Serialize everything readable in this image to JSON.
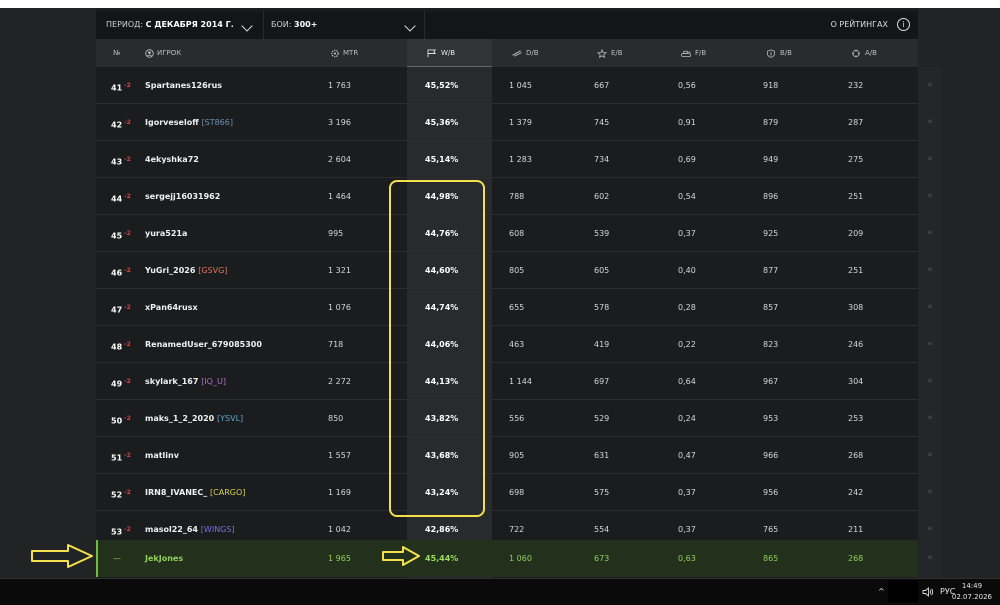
{
  "filters": {
    "period_label": "ПЕРИОД:",
    "period_value": "С ДЕКАБРЯ 2014 Г.",
    "battles_label": "БОИ:",
    "battles_value": "300+",
    "about_ratings": "О РЕЙТИНГАХ"
  },
  "columns": [
    "№",
    "ИГРОК",
    "MTR",
    "W/B",
    "D/B",
    "E/B",
    "F/B",
    "B/B",
    "A/B"
  ],
  "rows": [
    {
      "rank": "41",
      "change": "-2",
      "player": "Spartanes126rus",
      "clan": "",
      "clan_color": "",
      "mtr": "1 763",
      "wb": "45,52%",
      "db": "1 045",
      "eb": "667",
      "fb": "0,56",
      "bb": "918",
      "ab": "232"
    },
    {
      "rank": "42",
      "change": "-2",
      "player": "Igorveseloff",
      "clan": "[ST866]",
      "clan_color": "#6c8fb5",
      "mtr": "3 196",
      "wb": "45,36%",
      "db": "1 379",
      "eb": "745",
      "fb": "0,91",
      "bb": "879",
      "ab": "287"
    },
    {
      "rank": "43",
      "change": "-2",
      "player": "4ekyshka72",
      "clan": "",
      "clan_color": "",
      "mtr": "2 604",
      "wb": "45,14%",
      "db": "1 283",
      "eb": "734",
      "fb": "0,69",
      "bb": "949",
      "ab": "275"
    },
    {
      "rank": "44",
      "change": "-2",
      "player": "sergejj16031962",
      "clan": "",
      "clan_color": "",
      "mtr": "1 464",
      "wb": "44,98%",
      "db": "788",
      "eb": "602",
      "fb": "0,54",
      "bb": "896",
      "ab": "251"
    },
    {
      "rank": "45",
      "change": "-2",
      "player": "yura521a",
      "clan": "",
      "clan_color": "",
      "mtr": "995",
      "wb": "44,76%",
      "db": "608",
      "eb": "539",
      "fb": "0,37",
      "bb": "925",
      "ab": "209"
    },
    {
      "rank": "46",
      "change": "-2",
      "player": "YuGri_2026",
      "clan": "[GSVG]",
      "clan_color": "#e0745a",
      "mtr": "1 321",
      "wb": "44,60%",
      "db": "805",
      "eb": "605",
      "fb": "0,40",
      "bb": "877",
      "ab": "251"
    },
    {
      "rank": "47",
      "change": "-2",
      "player": "xPan64rusx",
      "clan": "",
      "clan_color": "",
      "mtr": "1 076",
      "wb": "44,74%",
      "db": "655",
      "eb": "578",
      "fb": "0,28",
      "bb": "857",
      "ab": "308"
    },
    {
      "rank": "48",
      "change": "-2",
      "player": "RenamedUser_679085300",
      "clan": "",
      "clan_color": "",
      "mtr": "718",
      "wb": "44,06%",
      "db": "463",
      "eb": "419",
      "fb": "0,22",
      "bb": "823",
      "ab": "246"
    },
    {
      "rank": "49",
      "change": "-2",
      "player": "skylark_167",
      "clan": "[IQ_U]",
      "clan_color": "#b56ad0",
      "mtr": "2 272",
      "wb": "44,13%",
      "db": "1 144",
      "eb": "697",
      "fb": "0,64",
      "bb": "967",
      "ab": "304"
    },
    {
      "rank": "50",
      "change": "-2",
      "player": "maks_1_2_2020",
      "clan": "[YSVL]",
      "clan_color": "#5fa3c9",
      "mtr": "850",
      "wb": "43,82%",
      "db": "556",
      "eb": "529",
      "fb": "0,24",
      "bb": "953",
      "ab": "253"
    },
    {
      "rank": "51",
      "change": "-2",
      "player": "matlinv",
      "clan": "",
      "clan_color": "",
      "mtr": "1 557",
      "wb": "43,68%",
      "db": "905",
      "eb": "631",
      "fb": "0,47",
      "bb": "966",
      "ab": "268"
    },
    {
      "rank": "52",
      "change": "-2",
      "player": "IRN8_IVANEC_",
      "clan": "[CARGO]",
      "clan_color": "#d6d64a",
      "mtr": "1 169",
      "wb": "43,24%",
      "db": "698",
      "eb": "575",
      "fb": "0,37",
      "bb": "956",
      "ab": "242"
    },
    {
      "rank": "53",
      "change": "-2",
      "player": "masol22_64",
      "clan": "[WINGS]",
      "clan_color": "#7a6fe0",
      "mtr": "1 042",
      "wb": "42,86%",
      "db": "722",
      "eb": "554",
      "fb": "0,37",
      "bb": "765",
      "ab": "211"
    }
  ],
  "current_player": {
    "rank": "—",
    "player": "JekJones",
    "mtr": "1 965",
    "wb": "45,44%",
    "db": "1 060",
    "eb": "673",
    "fb": "0,63",
    "bb": "865",
    "ab": "268"
  },
  "side_glyph": "«",
  "taskbar": {
    "up_arrow": "^",
    "language": "РУС",
    "time": "14:49",
    "date": "02.07.2026"
  },
  "colors": {
    "rank_change": "#e0403a",
    "current_player": "#8fd05a",
    "annotation": "#f4e04d"
  }
}
